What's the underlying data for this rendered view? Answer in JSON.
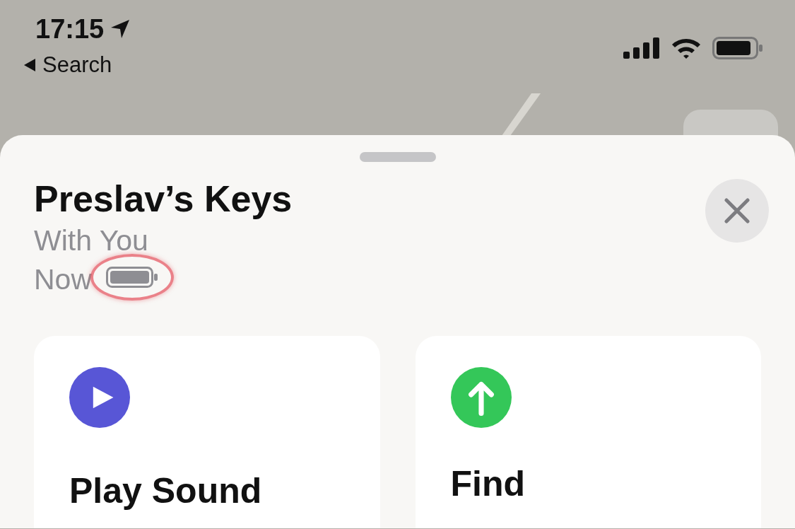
{
  "status_bar": {
    "time": "17:15",
    "back_label": "Search"
  },
  "sheet": {
    "title": "Preslav’s Keys",
    "subtitle": "With You",
    "updated": "Now"
  },
  "actions": [
    {
      "kind": "play",
      "label": "Play Sound",
      "color": "#5856d6"
    },
    {
      "kind": "find",
      "label": "Find",
      "color": "#34c759"
    }
  ]
}
